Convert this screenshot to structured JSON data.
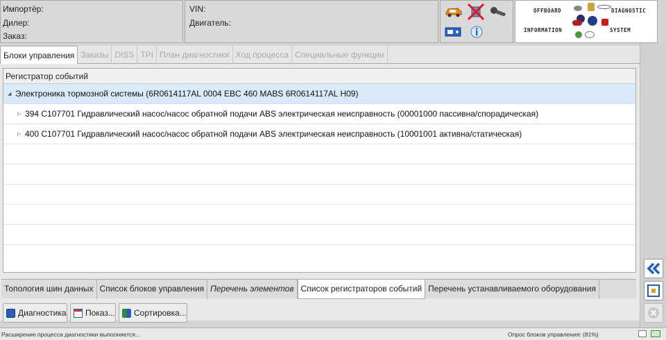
{
  "header": {
    "importer_label": "Импортёр:",
    "dealer_label": "Дилер:",
    "order_label": "Заказ:",
    "vin_label": "VIN:",
    "engine_label": "Двигатель:",
    "logo": {
      "offboard": "OFFBOARD",
      "diagnostic": "DIAGNOSTIC",
      "information": "INFORMATION",
      "system": "SYSTEM"
    }
  },
  "tabs": [
    {
      "label": "Блоки управления",
      "active": true
    },
    {
      "label": "Заказы",
      "active": false
    },
    {
      "label": "DISS",
      "active": false
    },
    {
      "label": "TPI",
      "active": false
    },
    {
      "label": "План диагностики",
      "active": false
    },
    {
      "label": "Ход процесса",
      "active": false
    },
    {
      "label": "Специальные функции",
      "active": false
    }
  ],
  "panel": {
    "title": "Регистратор событий",
    "root_row": "Электроника тормозной системы (6R0614117AL   0004   EBC 460 MABS    6R0614117AL   H09)",
    "rows": [
      "394   C107701   Гидравлический насос/насос обратной подачи ABS электрическая неисправность  (00001000   пассивна/спорадическая)",
      "400   C107701   Гидравлический насос/насос обратной подачи ABS электрическая неисправность  (10001001   активна/статическая)"
    ]
  },
  "bottom_tabs": [
    {
      "label": "Топология шин данных",
      "active": false,
      "italic": false
    },
    {
      "label": "Список блоков управления",
      "active": false,
      "italic": false
    },
    {
      "label": "Перечень элементов",
      "active": false,
      "italic": true
    },
    {
      "label": "Список регистраторов событий",
      "active": true,
      "italic": false
    },
    {
      "label": "Перечень устанавливаемого оборудования",
      "active": false,
      "italic": false
    }
  ],
  "actions": {
    "diagnostics": "Диагностика",
    "show": "Показ...",
    "sort": "Сортировка..."
  },
  "status": {
    "left": "Расширение процесса диагностики выполняется...",
    "right": "Опрос блоков управления: (81%)"
  },
  "colors": {
    "selected_row": "#d9ebfa",
    "accent_blue": "#1f5fbf"
  }
}
